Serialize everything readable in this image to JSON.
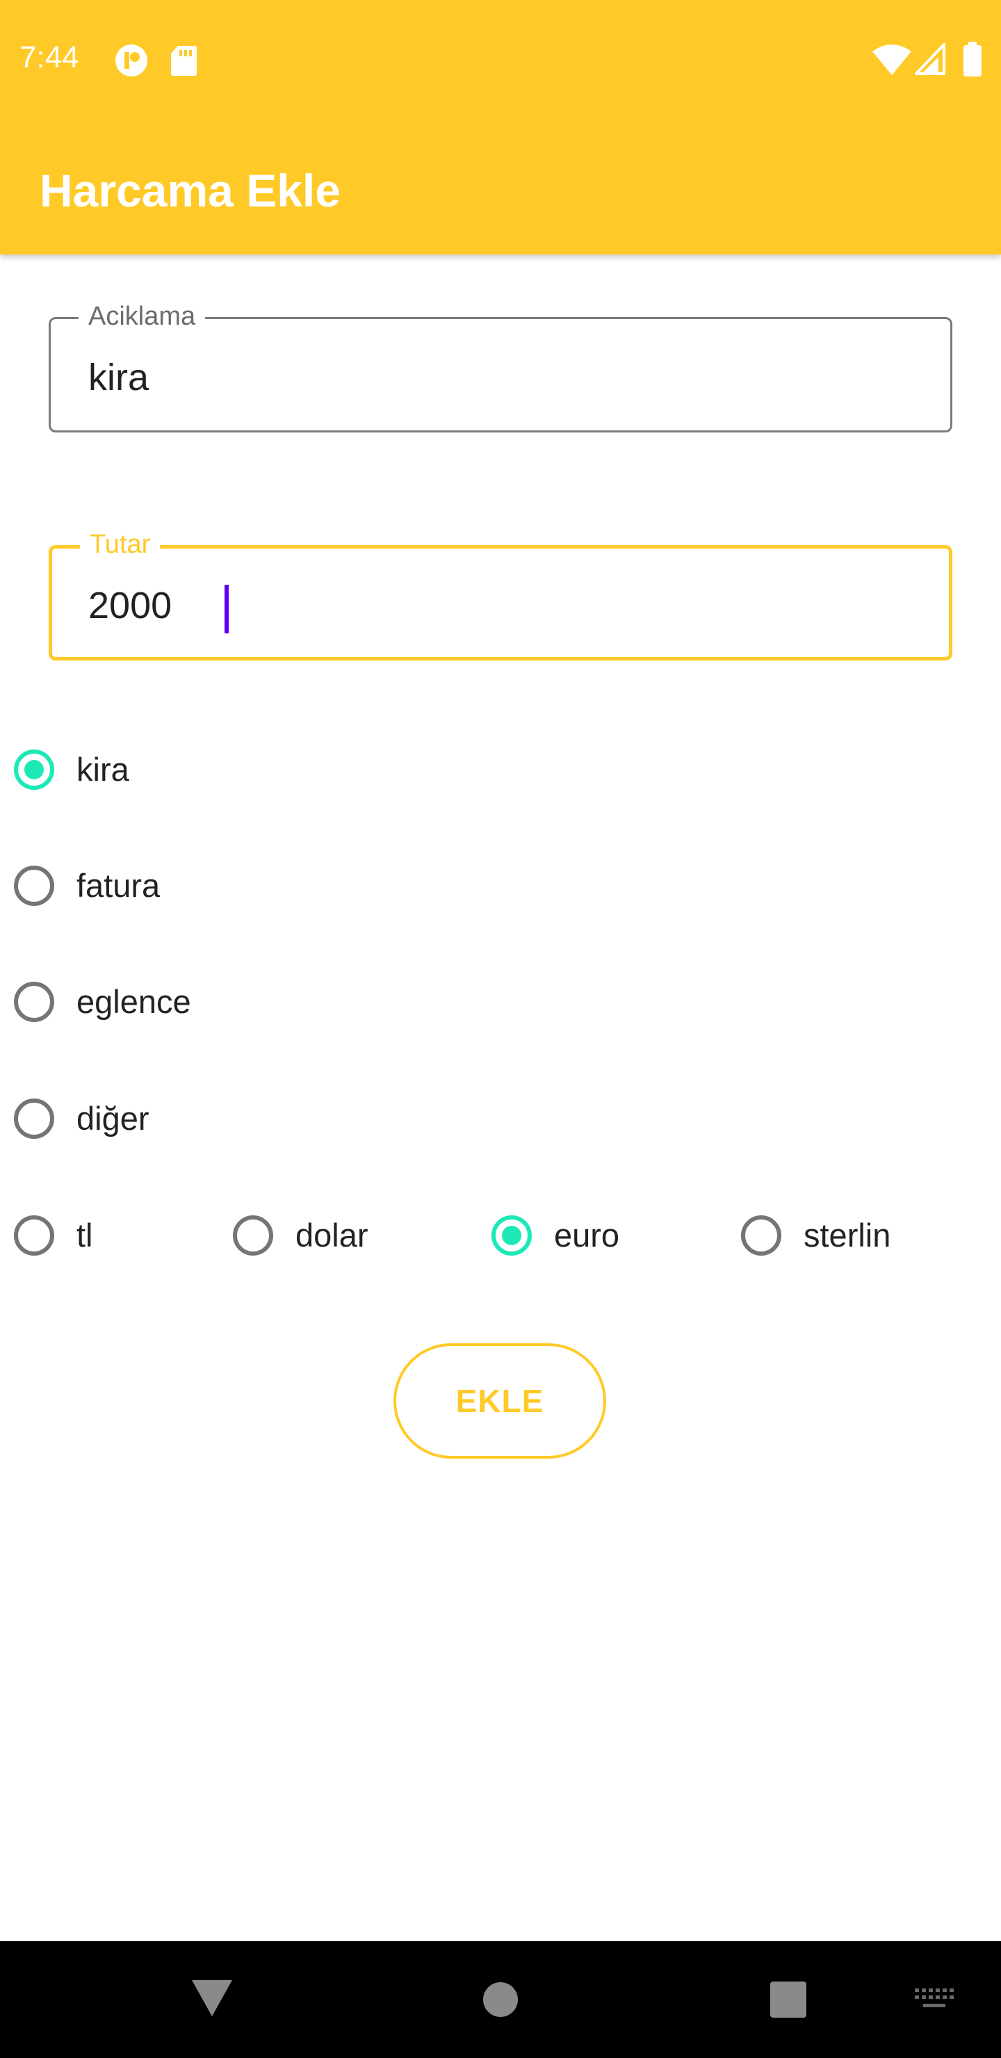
{
  "status_bar": {
    "time": "7:44",
    "left_icons": [
      "notification-app-icon",
      "sd-card-icon"
    ],
    "right_icons": [
      "wifi-icon",
      "signal-icon",
      "battery-icon"
    ]
  },
  "app_bar": {
    "title": "Harcama Ekle",
    "color": "#FFCA28"
  },
  "form": {
    "aciklama": {
      "label": "Aciklama",
      "value": "kira"
    },
    "tutar": {
      "label": "Tutar",
      "value": "2000",
      "focused": true
    }
  },
  "categories": {
    "selected": "kira",
    "options": [
      {
        "label": "kira",
        "checked": true
      },
      {
        "label": "fatura",
        "checked": false
      },
      {
        "label": "eglence",
        "checked": false
      },
      {
        "label": "diğer",
        "checked": false
      }
    ]
  },
  "currencies": {
    "selected": "euro",
    "options": [
      {
        "label": "tl",
        "checked": false
      },
      {
        "label": "dolar",
        "checked": false
      },
      {
        "label": "euro",
        "checked": true
      },
      {
        "label": "sterlin",
        "checked": false
      }
    ]
  },
  "actions": {
    "ekle_label": "EKLE"
  },
  "colors": {
    "accent": "#FFCA28",
    "radio_checked": "#1DE9B6",
    "cursor": "#6200EE"
  },
  "nav_bar": {
    "icons": [
      "back-triangle-icon",
      "home-circle-icon",
      "recents-square-icon",
      "keyboard-icon"
    ]
  }
}
